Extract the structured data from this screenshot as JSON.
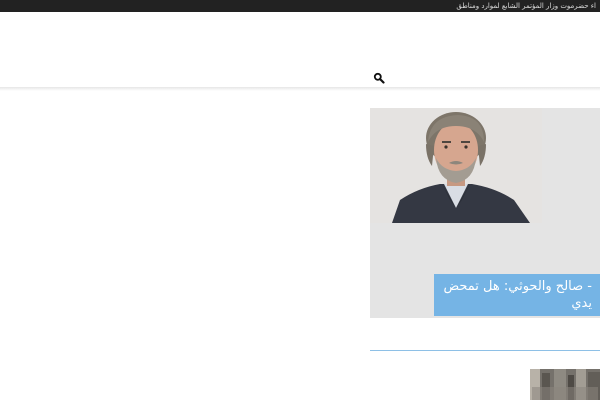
{
  "topbar": {
    "ticker_bold": "حضرموت",
    "ticker_text": "اء حضرموت وزار المؤتمر الشابع لموارد ومناطق"
  },
  "header": {
    "search_icon": "search-icon"
  },
  "featured": {
    "caption_line1": "- صالح والحوثي: هل تمحض",
    "caption_line2": "يدي"
  },
  "colors": {
    "topbar": "#222222",
    "caption_bg": "#75b4e5",
    "card_bg": "#e4e4e4",
    "rule": "#8ec0e6"
  }
}
